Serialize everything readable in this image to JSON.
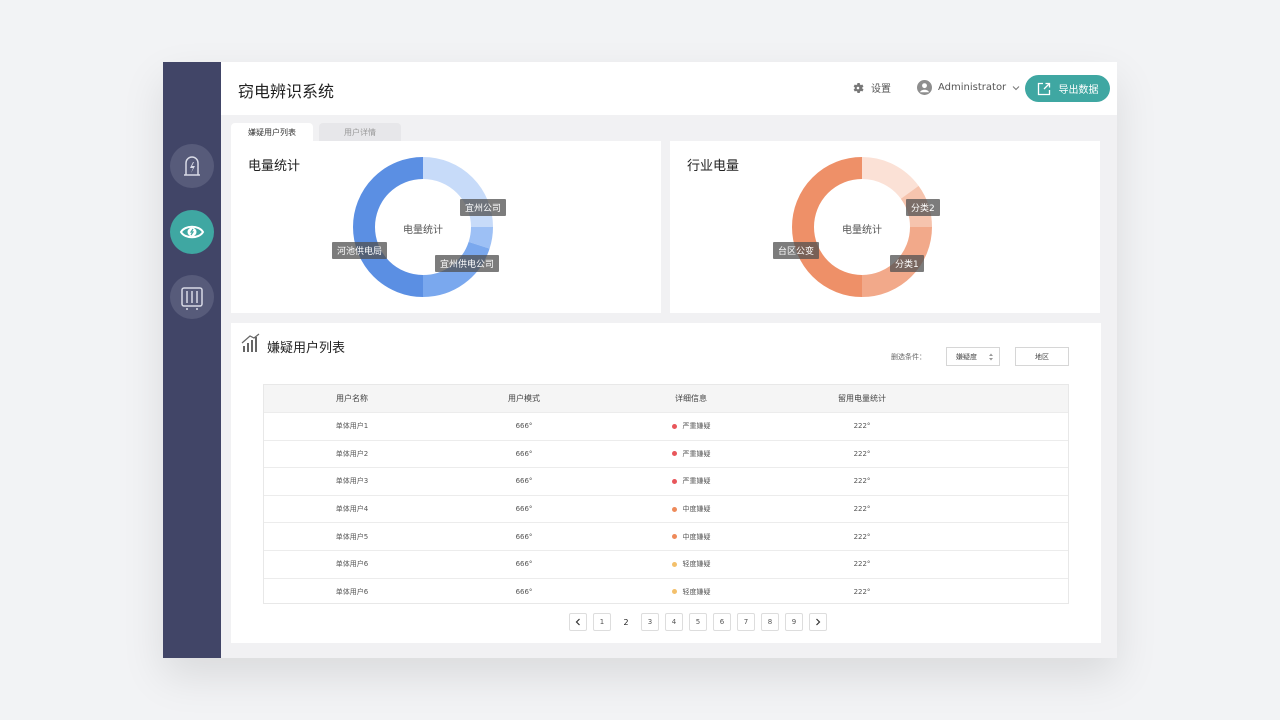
{
  "header": {
    "title": "窃电辨识系统",
    "settings_label": "设置",
    "user_name": "Administrator",
    "export_label": "导出数据"
  },
  "sidebar": {
    "items": [
      {
        "icon": "power-station-icon",
        "active": false
      },
      {
        "icon": "eye-icon",
        "active": true
      },
      {
        "icon": "meter-box-icon",
        "active": false
      }
    ]
  },
  "tabs": [
    {
      "label": "嫌疑用户列表",
      "active": true
    },
    {
      "label": "用户详情",
      "active": false
    }
  ],
  "cards": {
    "power_stats": {
      "title": "电量统计",
      "center_label": "电量统计",
      "segments": [
        {
          "label": "宜州公司",
          "value": 25,
          "color": "#c7dbf9"
        },
        {
          "label": "",
          "value": 5,
          "color": "#9dc0f5"
        },
        {
          "label": "宜州供电公司",
          "value": 20,
          "color": "#7aa8ee"
        },
        {
          "label": "河池供电局",
          "value": 50,
          "color": "#5b8fe3"
        }
      ]
    },
    "industry_power": {
      "title": "行业电量",
      "center_label": "电量统计",
      "segments": [
        {
          "label": "分类2",
          "value": 15,
          "color": "#fbe1d6"
        },
        {
          "label": "",
          "value": 10,
          "color": "#f6c4ae"
        },
        {
          "label": "分类1",
          "value": 25,
          "color": "#f2a98a"
        },
        {
          "label": "台区公变",
          "value": 50,
          "color": "#ee9068"
        }
      ]
    }
  },
  "suspect_list": {
    "title": "嫌疑用户列表",
    "filter_label": "删选条件：",
    "filter_select": "嫌疑度",
    "filter_region": "地区",
    "columns": [
      "用户名称",
      "用户模式",
      "详细信息",
      "留用电量统计"
    ],
    "rows": [
      {
        "name": "单体用户1",
        "mode": "666°",
        "detail": "严重嫌疑",
        "level": "high",
        "stat": "222°"
      },
      {
        "name": "单体用户2",
        "mode": "666°",
        "detail": "严重嫌疑",
        "level": "high",
        "stat": "222°"
      },
      {
        "name": "单体用户3",
        "mode": "666°",
        "detail": "严重嫌疑",
        "level": "high",
        "stat": "222°"
      },
      {
        "name": "单体用户4",
        "mode": "666°",
        "detail": "中度嫌疑",
        "level": "mid",
        "stat": "222°"
      },
      {
        "name": "单体用户5",
        "mode": "666°",
        "detail": "中度嫌疑",
        "level": "mid",
        "stat": "222°"
      },
      {
        "name": "单体用户6",
        "mode": "666°",
        "detail": "轻度嫌疑",
        "level": "low",
        "stat": "222°"
      },
      {
        "name": "单体用户6",
        "mode": "666°",
        "detail": "轻度嫌疑",
        "level": "low",
        "stat": "222°"
      }
    ],
    "level_colors": {
      "high": "#e8565b",
      "mid": "#ee8a5a",
      "low": "#f3c06b"
    }
  },
  "pagination": {
    "pages": [
      "1",
      "2",
      "3",
      "4",
      "5",
      "6",
      "7",
      "8",
      "9"
    ],
    "current": "2"
  },
  "colors": {
    "sidebar": "#414567",
    "accent": "#3fa7a2"
  }
}
